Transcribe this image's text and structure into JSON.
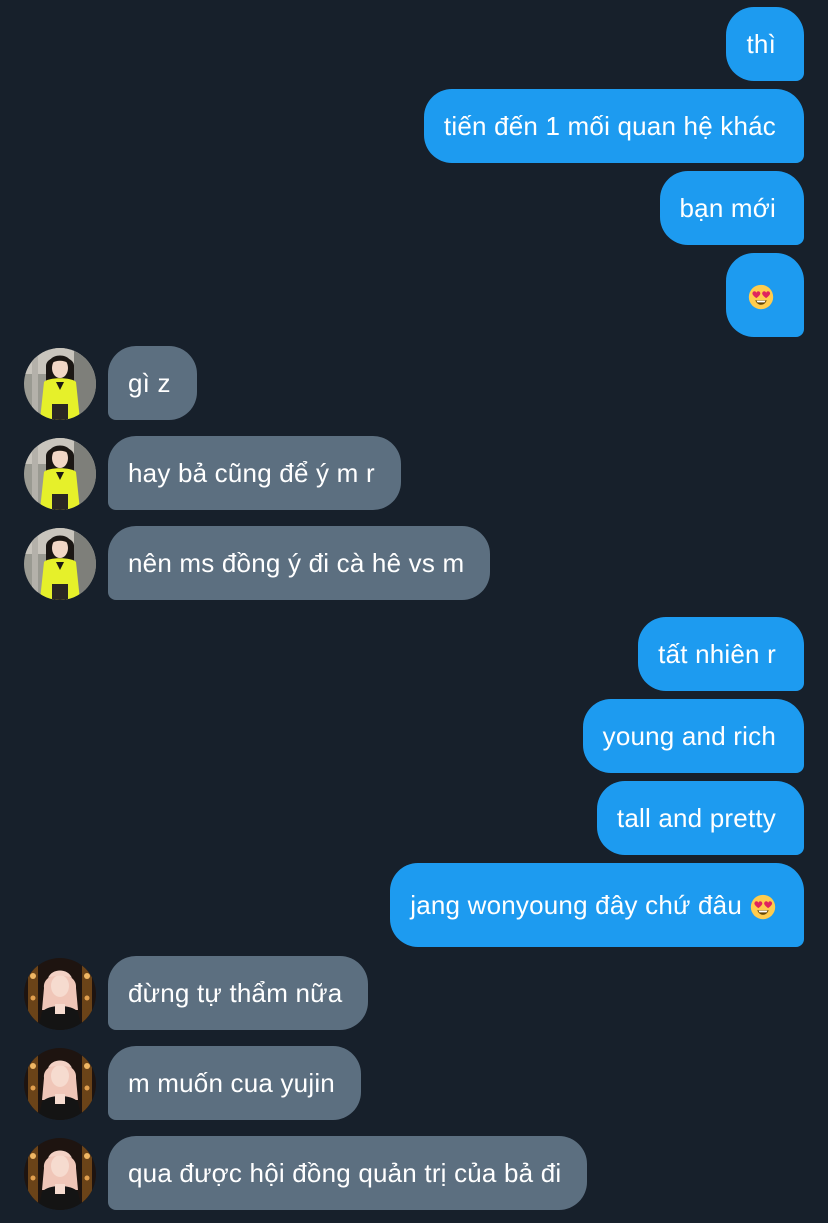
{
  "conversation": {
    "messages": [
      {
        "direction": "sent",
        "text": "thì"
      },
      {
        "direction": "sent",
        "text": "tiến đến 1 mối quan hệ khác"
      },
      {
        "direction": "sent",
        "text": "bạn mới"
      },
      {
        "direction": "sent",
        "text": "",
        "emoji": "heart-eyes-emoji-icon"
      },
      {
        "direction": "received",
        "text": "gì z",
        "avatar": "avatar-yellow-outfit"
      },
      {
        "direction": "received",
        "text": "hay bả cũng để ý m r",
        "avatar": "avatar-yellow-outfit"
      },
      {
        "direction": "received",
        "text": "nên ms đồng ý đi cà hê vs m",
        "avatar": "avatar-yellow-outfit"
      },
      {
        "direction": "sent",
        "text": "tất nhiên r"
      },
      {
        "direction": "sent",
        "text": "young and rich"
      },
      {
        "direction": "sent",
        "text": "tall and pretty"
      },
      {
        "direction": "sent",
        "text": "jang wonyoung đây chứ đâu",
        "emoji": "heart-eyes-emoji-icon"
      },
      {
        "direction": "received",
        "text": "đừng tự thẩm nữa",
        "avatar": "avatar-blonde-dark-outfit"
      },
      {
        "direction": "received",
        "text": "m muốn cua yujin",
        "avatar": "avatar-blonde-dark-outfit"
      },
      {
        "direction": "received",
        "text": "qua được hội đồng quản trị của bả đi",
        "avatar": "avatar-blonde-dark-outfit"
      }
    ]
  },
  "colors": {
    "background": "#17202b",
    "sent_bubble": "#1d9bf0",
    "received_bubble": "#5c6f80",
    "text": "#ffffff"
  }
}
